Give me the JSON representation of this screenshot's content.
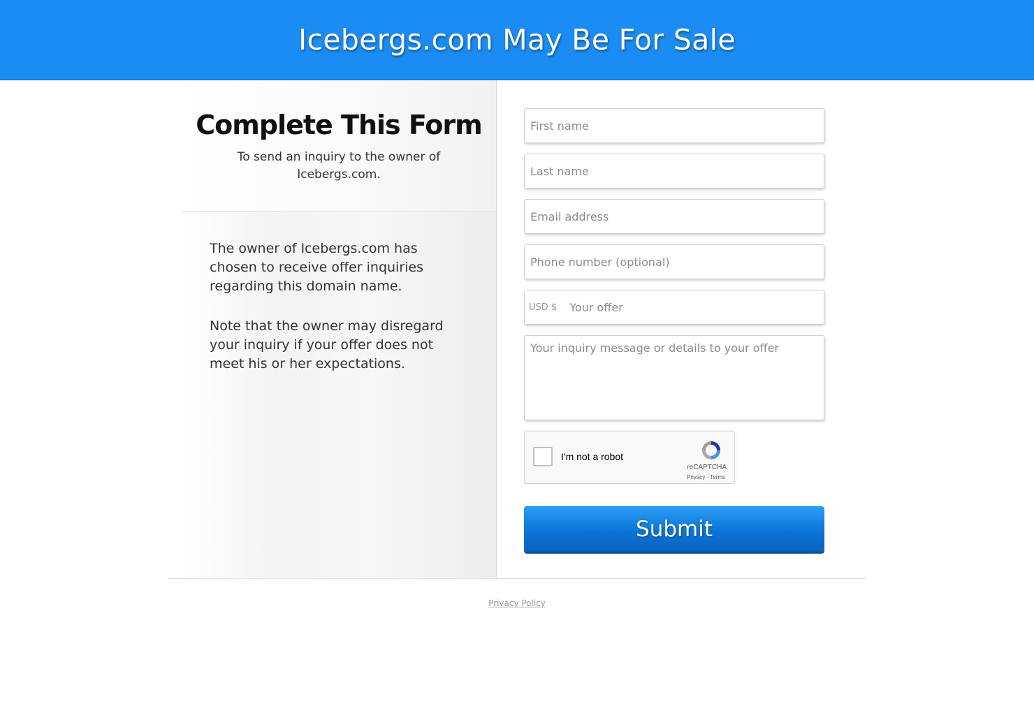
{
  "header": {
    "title": "Icebergs.com May Be For Sale"
  },
  "left": {
    "heading": "Complete This Form",
    "subheading": "To send an inquiry to the owner of Icebergs.com.",
    "paragraph1": "The owner of Icebergs.com has chosen to receive offer inquiries regarding this domain name.",
    "paragraph2": "Note that the owner may disregard your inquiry if your offer does not meet his or her expectations."
  },
  "form": {
    "first_name_placeholder": "First name",
    "last_name_placeholder": "Last name",
    "email_placeholder": "Email address",
    "phone_placeholder": "Phone number (optional)",
    "offer_prefix": "USD $",
    "offer_placeholder": "Your offer",
    "message_placeholder": "Your inquiry message or details to your offer",
    "captcha": {
      "label": "I'm not a robot",
      "brand": "reCAPTCHA",
      "terms": "Privacy - Terms"
    },
    "submit_label": "Submit"
  },
  "footer": {
    "privacy_link": "Privacy Policy"
  },
  "colors": {
    "header_bg": "#1a8cf3",
    "submit_bg": "#0b74d8"
  }
}
